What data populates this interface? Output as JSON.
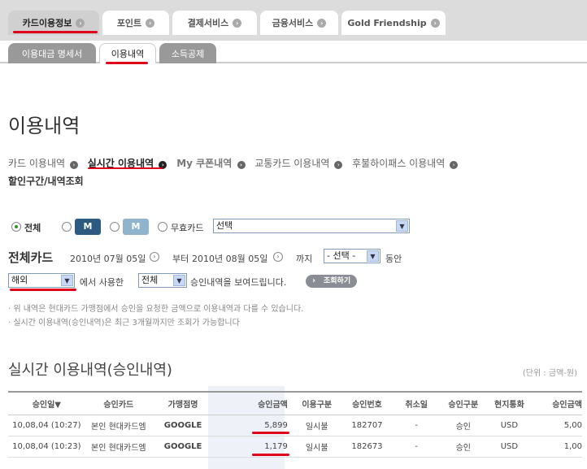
{
  "top_tabs": [
    {
      "label": "카드이용정보"
    },
    {
      "label": "포인트"
    },
    {
      "label": "결제서비스"
    },
    {
      "label": "금융서비스"
    },
    {
      "label": "Gold Friendship"
    }
  ],
  "sub_tabs": [
    {
      "label": "이용대금 명세서"
    },
    {
      "label": "이용내역"
    },
    {
      "label": "소득공제"
    }
  ],
  "page_title": "이용내역",
  "categories": [
    {
      "label": "카드 이용내역"
    },
    {
      "label": "실시간 이용내역"
    },
    {
      "label": "My 쿠폰내역"
    },
    {
      "label": "교통카드 이용내역"
    },
    {
      "label": "후불하이패스 이용내역"
    },
    {
      "label": "할인구간/내역조회"
    }
  ],
  "filter": {
    "all_label": "전체",
    "card_m1": "M",
    "card_m2": "M",
    "free_card_label": "무효카드",
    "free_card_select": "선택",
    "all_card_label": "전체카드",
    "date_from": "2010년 07월 05일",
    "from_suffix": "부터",
    "date_to": "2010년 08월 05일",
    "to_suffix": "까지",
    "period_select": "- 선택 -",
    "period_suffix": "동안",
    "region_select": "해외",
    "region_suffix": "에서 사용한",
    "type_select": "전체",
    "type_suffix": "승인내역을 보여드립니다.",
    "search_button": "조회하기"
  },
  "notes": [
    "· 위 내역은 현대카드 가맹점에서 승인을 요청한 금액으로 이용내역과 다를 수 있습니다.",
    "· 실시간 이용내역(승인내역)은 최근 3개월까지만 조회가 가능합니다"
  ],
  "section_title": "실시간 이용내역(승인내역)",
  "unit_label": "(단위 : 금액-원)",
  "table": {
    "headers": [
      "승인일▼",
      "승인카드",
      "가맹점명",
      "승인금액",
      "이용구분",
      "승인번호",
      "취소일",
      "승인구분",
      "현지통화",
      "승인금액"
    ],
    "rows": [
      [
        "10,08,04 (10:27)",
        "본인 현대카드엠",
        "GOOGLE",
        "5,899",
        "일시불",
        "182707",
        "-",
        "승인",
        "USD",
        "5,00"
      ],
      [
        "10,08,04 (10:23)",
        "본인 현대카드엠",
        "GOOGLE",
        "1,179",
        "일시불",
        "182673",
        "-",
        "승인",
        "USD",
        "1,00"
      ]
    ]
  },
  "colors": {
    "accent_red": "#e0001a",
    "google": "#d88a00",
    "card_dark": "#2c5a80",
    "card_light": "#8fb4cc"
  }
}
